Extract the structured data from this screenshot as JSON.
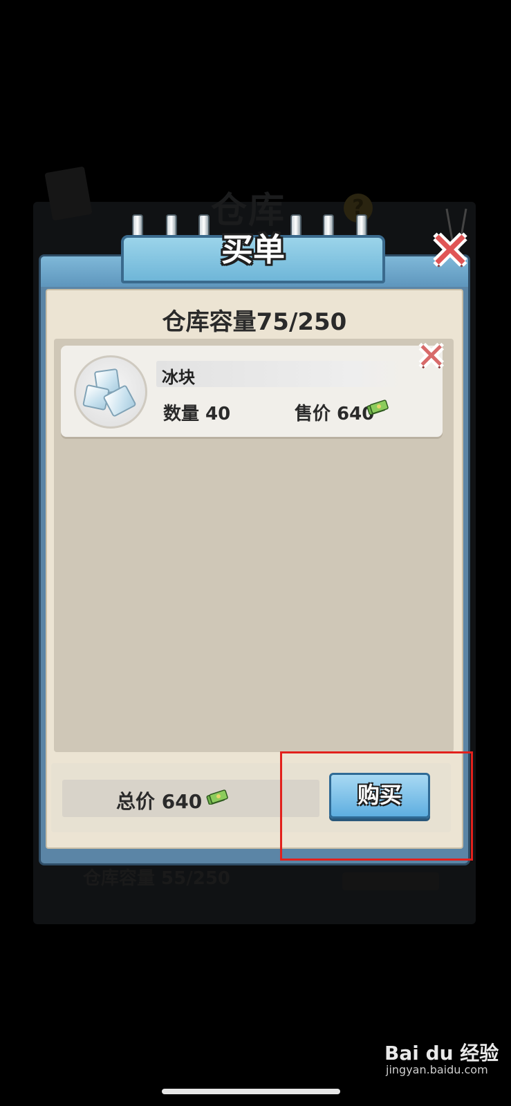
{
  "background": {
    "screen_title": "仓库",
    "bottom_capacity_text": "仓库容量 55/250"
  },
  "dialog": {
    "title": "买单",
    "capacity_text": "仓库容量75/250",
    "items": [
      {
        "name": "冰块",
        "quantity_text": "数量 40",
        "price_text": "售价 640",
        "icon": "ice-cube-icon"
      }
    ],
    "total_text": "总价 640",
    "buy_label": "购买",
    "currency_icon": "cash-icon"
  },
  "annotation": {
    "highlight_color": "#e2211c"
  },
  "watermark": {
    "brand": "Bai du 经验",
    "url": "jingyan.baidu.com"
  }
}
